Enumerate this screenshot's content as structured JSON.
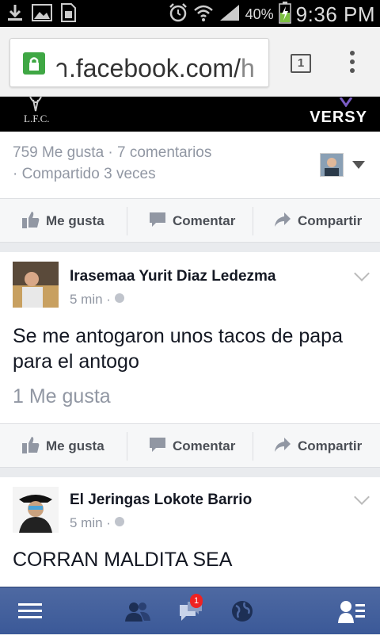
{
  "status_bar": {
    "battery_percent": "40%",
    "time": "9:36 PM",
    "icons": [
      "download-icon",
      "gallery-icon",
      "sim-icon",
      "alarm-icon",
      "wifi-icon",
      "signal-icon",
      "battery-charging-icon"
    ]
  },
  "browser": {
    "url_prefix": "า",
    "url_main": ".facebook.com/",
    "url_suffix": "h",
    "tab_count": "1"
  },
  "banner": {
    "left_text": "L.F.C.",
    "right_text": "VERSY"
  },
  "top_post": {
    "stats_line1": "759 Me gusta · 7 comentarios",
    "stats_line2": "· Compartido 3 veces"
  },
  "actions": {
    "like": "Me gusta",
    "comment": "Comentar",
    "share": "Compartir"
  },
  "posts": [
    {
      "author": "Irasemaa Yurit Diaz Ledezma",
      "time": "5 min ·",
      "text": "Se me antogaron unos tacos de papa para el antogo",
      "likes": "1 Me gusta"
    },
    {
      "author": "El Jeringas Lokote Barrio",
      "time": "5 min ·",
      "text": "CORRAN MALDITA SEA"
    }
  ],
  "bottom_nav": {
    "messages_badge": "1"
  },
  "colors": {
    "facebook_blue": "#3b5998",
    "secure_green": "#3fa744"
  }
}
